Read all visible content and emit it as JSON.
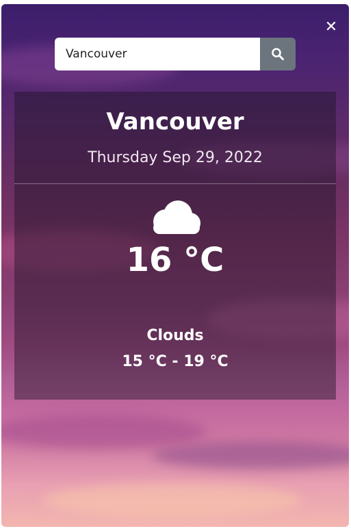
{
  "window": {
    "close_label": "✕"
  },
  "search": {
    "value": "Vancouver",
    "placeholder": "",
    "button_icon": "search-icon"
  },
  "weather": {
    "city": "Vancouver",
    "date": "Thursday Sep 29, 2022",
    "icon": "cloud-icon",
    "temperature": "16 °C",
    "condition": "Clouds",
    "range": "15 °C - 19 °C"
  },
  "colors": {
    "search_button": "#6c757d",
    "card_overlay": "rgba(30,20,40,0.45)",
    "text": "#ffffff"
  }
}
